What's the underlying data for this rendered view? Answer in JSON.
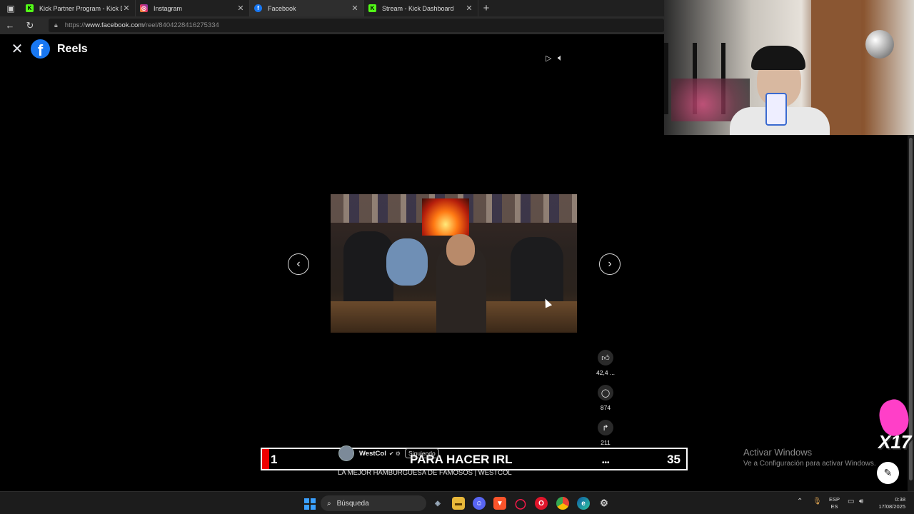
{
  "browser": {
    "tabs": [
      {
        "title": "Kick Partner Program - Kick Dash",
        "favicon": "kick-icon",
        "active": false
      },
      {
        "title": "Instagram",
        "favicon": "instagram-icon",
        "active": false
      },
      {
        "title": "Facebook",
        "favicon": "facebook-icon",
        "active": true
      },
      {
        "title": "Stream - Kick Dashboard",
        "favicon": "kick-icon",
        "active": false
      }
    ],
    "url_prefix": "https://",
    "url_host": "www.facebook.com",
    "url_path": "/reel/8404228416275334"
  },
  "reels": {
    "title": "Reels",
    "actions": {
      "likes": "42,4 ...",
      "comments": "874",
      "shares": "211"
    },
    "author": {
      "name": "WestCol",
      "follow_label": "Siguiendo"
    },
    "caption": "LA MEJOR HAMBURGUESA DE FAMOSOS | WESTCOL"
  },
  "stream_overlay": {
    "left_number": "1",
    "text": "PARA HACER IRL",
    "right_number": "35",
    "multiplier": "X17"
  },
  "windows": {
    "activate_title": "Activar Windows",
    "activate_subtitle": "Ve a Configuración para activar Windows.",
    "search_placeholder": "Búsqueda",
    "lang_top": "ESP",
    "lang_bottom": "ES",
    "time": "0:38",
    "date": "17/08/2025"
  },
  "colors": {
    "facebook_blue": "#1877f2",
    "kick_green": "#53fc18",
    "overlay_red": "#ee0000"
  }
}
